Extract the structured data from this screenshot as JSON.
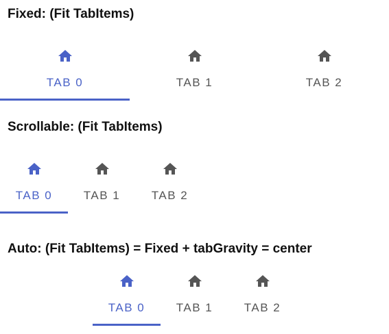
{
  "colors": {
    "accent": "#4a62c7",
    "inactive": "#555555",
    "inactive_icon": "#555555"
  },
  "sections": [
    {
      "title": "Fixed: (Fit TabItems)",
      "selected_index": 0,
      "tabs": [
        {
          "label": "TAB 0",
          "icon": "home-icon"
        },
        {
          "label": "TAB 1",
          "icon": "home-icon"
        },
        {
          "label": "TAB 2",
          "icon": "home-icon"
        }
      ]
    },
    {
      "title": "Scrollable: (Fit TabItems)",
      "selected_index": 0,
      "tabs": [
        {
          "label": "TAB 0",
          "icon": "home-icon"
        },
        {
          "label": "TAB 1",
          "icon": "home-icon"
        },
        {
          "label": "TAB 2",
          "icon": "home-icon"
        }
      ]
    },
    {
      "title": "Auto: (Fit TabItems) = Fixed + tabGravity = center",
      "selected_index": 0,
      "tabs": [
        {
          "label": "TAB 0",
          "icon": "home-icon"
        },
        {
          "label": "TAB 1",
          "icon": "home-icon"
        },
        {
          "label": "TAB 2",
          "icon": "home-icon"
        }
      ]
    }
  ]
}
